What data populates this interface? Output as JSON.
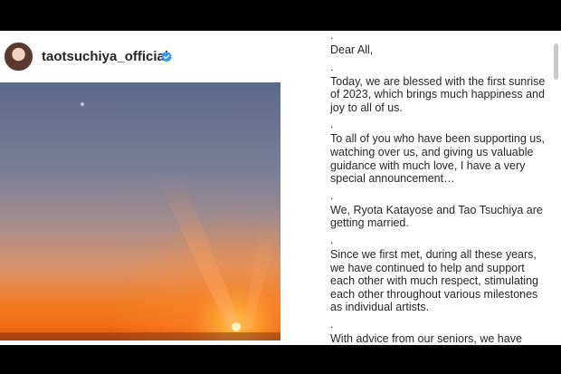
{
  "profile": {
    "username": "taotsuchiya_official",
    "verified_icon": "verified-badge-icon"
  },
  "colors": {
    "verified_blue": "#3897f0",
    "sky_top": "#5b6a8a",
    "sunset_orange": "#f07a22"
  },
  "caption": {
    "dot": ".",
    "paragraphs": [
      "Dear All,",
      "Today, we are blessed with the first sunrise of 2023, which brings much happiness and joy to all of us.",
      "To all of you who have been supporting us, watching over us, and giving us valuable guidance with much love, I have a very special announcement…",
      "We, Ryota Katayose and Tao Tsuchiya are getting married.",
      "Since we first met, during all these years, we have continued to help and support each other with much respect, stimulating each other throughout various milestones as individual artists.",
      "With advice from our seniors, we have been making preparations for our marriage.  At the end of last year, in the midst of all of this, we discovered and are"
    ]
  }
}
